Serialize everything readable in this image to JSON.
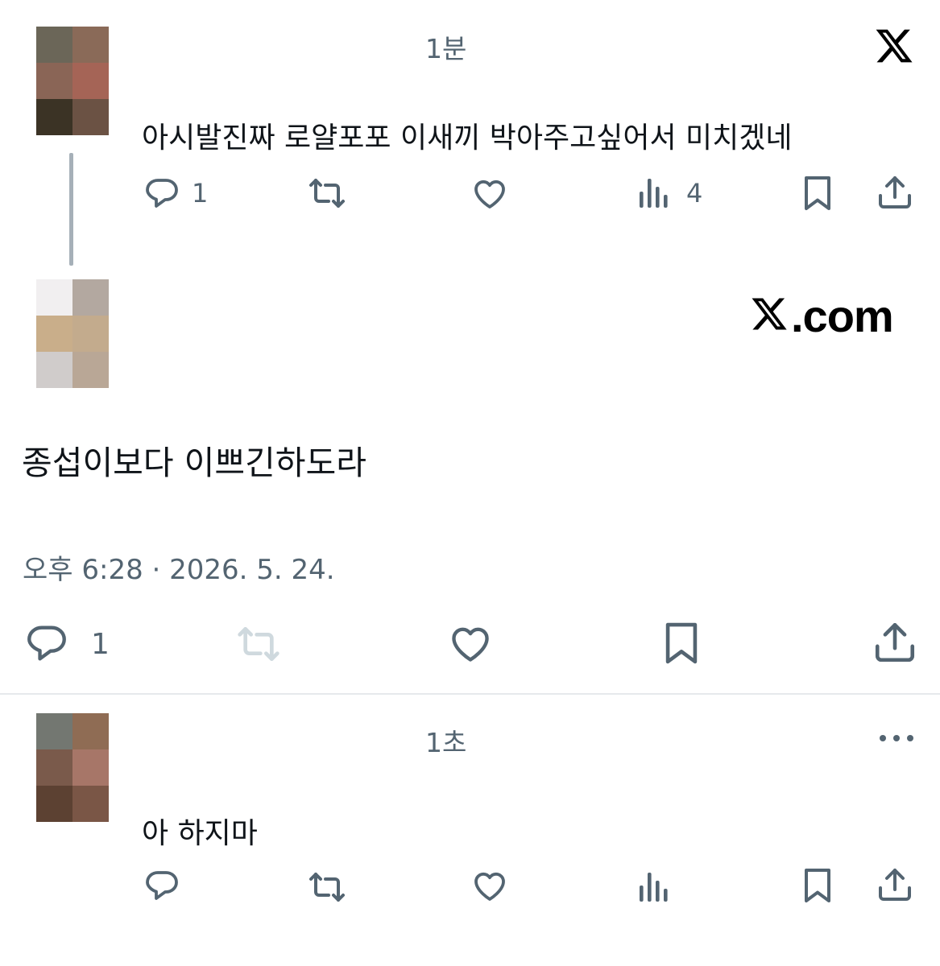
{
  "reply_top": {
    "time": "1분",
    "text": "아시발진짜 로얄포포 이새끼 박아주고싶어서 미치겠네",
    "reply_count": "1",
    "view_count": "4",
    "avatar_colors": [
      "#6b6658",
      "#8a6a58",
      "#8a6556",
      "#a56456",
      "#3b3325",
      "#6b5244"
    ]
  },
  "main_tweet": {
    "brand_text": ".com",
    "text": "종섭이보다 이쁘긴하도라",
    "timestamp": "오후 6:28 · 2026. 5. 24.",
    "reply_count": "1",
    "avatar_colors": [
      "#f1eff0",
      "#b3a8a0",
      "#c9ae8a",
      "#c3ab8d",
      "#d0cccb",
      "#b9a796"
    ]
  },
  "reply_bottom": {
    "time": "1초",
    "text": "아 하지마",
    "avatar_colors": [
      "#737771",
      "#8f6c54",
      "#7a5a4b",
      "#a77668",
      "#5c4132",
      "#7a5646"
    ]
  },
  "colors": {
    "icon": "#536471",
    "retweet_disabled": "#cfd9de",
    "text": "#0f1419"
  },
  "icons": [
    "x-logo",
    "reply-icon",
    "retweet-icon",
    "like-icon",
    "views-icon",
    "bookmark-icon",
    "share-icon",
    "more-icon"
  ]
}
